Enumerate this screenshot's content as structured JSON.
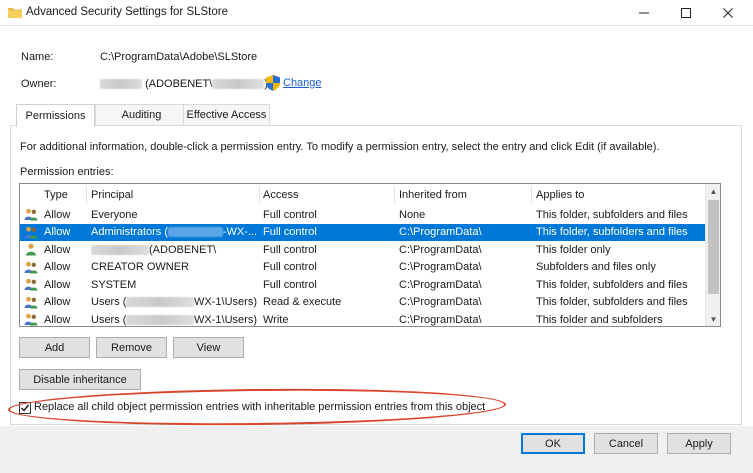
{
  "window": {
    "title": "Advanced Security Settings for SLStore",
    "minimize": "—",
    "maximize": "☐",
    "close": "✕"
  },
  "info": {
    "name_label": "Name:",
    "name_value": "C:\\ProgramData\\Adobe\\SLStore",
    "owner_label": "Owner:",
    "owner_value": "(ADOBENET\\",
    "owner_suffix": ")",
    "change_link": "Change"
  },
  "tabs": [
    {
      "label": "Permissions",
      "active": true
    },
    {
      "label": "Auditing",
      "active": false
    },
    {
      "label": "Effective Access",
      "active": false
    }
  ],
  "description": "For additional information, double-click a permission entry. To modify a permission entry, select the entry and click Edit (if available).",
  "entries_label": "Permission entries:",
  "table": {
    "columns": [
      "Type",
      "Principal",
      "Access",
      "Inherited from",
      "Applies to"
    ],
    "rows": [
      {
        "icon": "group-icon",
        "type": "Allow",
        "principal_pre": "Everyone",
        "principal_post": "",
        "access": "Full control",
        "inherited": "None",
        "applies": "This folder, subfolders and files",
        "selected": false
      },
      {
        "icon": "group-icon",
        "type": "Allow",
        "principal_pre": "Administrators (",
        "principal_post": "-WX-...",
        "access": "Full control",
        "inherited": "C:\\ProgramData\\",
        "applies": "This folder, subfolders and files",
        "selected": true
      },
      {
        "icon": "user-icon",
        "type": "Allow",
        "principal_pre": "",
        "principal_post": "(ADOBENET\\",
        "access": "Full control",
        "inherited": "C:\\ProgramData\\",
        "applies": "This folder only",
        "selected": false
      },
      {
        "icon": "group-icon",
        "type": "Allow",
        "principal_pre": "CREATOR OWNER",
        "principal_post": "",
        "access": "Full control",
        "inherited": "C:\\ProgramData\\",
        "applies": "Subfolders and files only",
        "selected": false
      },
      {
        "icon": "group-icon",
        "type": "Allow",
        "principal_pre": "SYSTEM",
        "principal_post": "",
        "access": "Full control",
        "inherited": "C:\\ProgramData\\",
        "applies": "This folder, subfolders and files",
        "selected": false
      },
      {
        "icon": "group-icon",
        "type": "Allow",
        "principal_pre": "Users (",
        "principal_post": "WX-1\\Users)",
        "access": "Read & execute",
        "inherited": "C:\\ProgramData\\",
        "applies": "This folder, subfolders and files",
        "selected": false
      },
      {
        "icon": "group-icon",
        "type": "Allow",
        "principal_pre": "Users (",
        "principal_post": "WX-1\\Users)",
        "access": "Write",
        "inherited": "C:\\ProgramData\\",
        "applies": "This folder and subfolders",
        "selected": false
      }
    ]
  },
  "buttons": {
    "add": "Add",
    "remove": "Remove",
    "view": "View",
    "disable_inheritance": "Disable inheritance",
    "ok": "OK",
    "cancel": "Cancel",
    "apply": "Apply"
  },
  "replace_checkbox": {
    "label": "Replace all child object permission entries with inheritable permission entries from this object",
    "checked": true
  },
  "colors": {
    "selection": "#0078d7",
    "link": "#1a5fd0",
    "highlight_ellipse": "#d9442e"
  }
}
